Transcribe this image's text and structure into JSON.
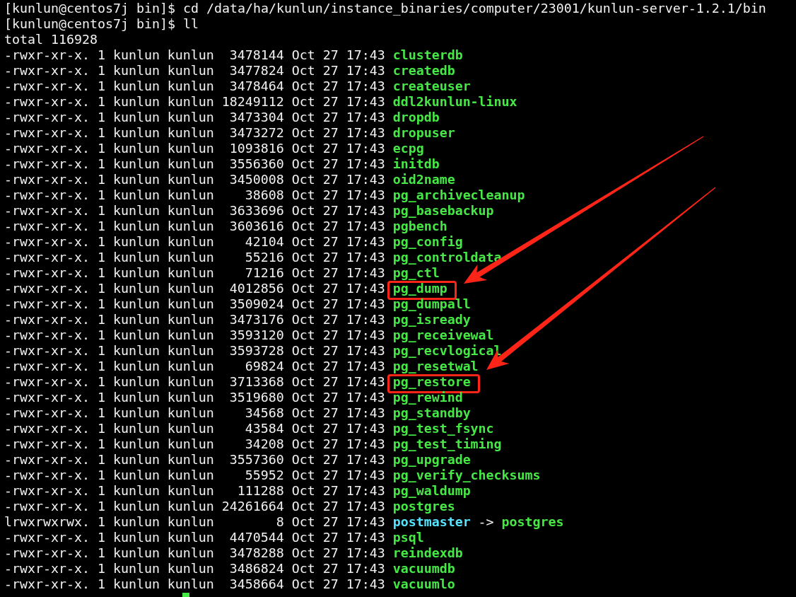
{
  "terminal": {
    "history": [
      {
        "kind": "prompt",
        "prompt": "[kunlun@centos7j bin]$",
        "command": "cd /data/ha/kunlun/instance_binaries/computer/23001/kunlun-server-1.2.1/bin"
      },
      {
        "kind": "prompt",
        "prompt": "[kunlun@centos7j bin]$",
        "command": "ll"
      },
      {
        "kind": "output",
        "text": "total 116928"
      }
    ],
    "listing": [
      {
        "permissions": "-rwxr-xr-x.",
        "links": "1",
        "owner": "kunlun",
        "group": "kunlun",
        "size": "3478144",
        "month": "Oct",
        "day": "27",
        "time": "17:43",
        "name": "clusterdb",
        "kind": "executable",
        "highlighted": false
      },
      {
        "permissions": "-rwxr-xr-x.",
        "links": "1",
        "owner": "kunlun",
        "group": "kunlun",
        "size": "3477824",
        "month": "Oct",
        "day": "27",
        "time": "17:43",
        "name": "createdb",
        "kind": "executable",
        "highlighted": false
      },
      {
        "permissions": "-rwxr-xr-x.",
        "links": "1",
        "owner": "kunlun",
        "group": "kunlun",
        "size": "3478464",
        "month": "Oct",
        "day": "27",
        "time": "17:43",
        "name": "createuser",
        "kind": "executable",
        "highlighted": false
      },
      {
        "permissions": "-rwxr-xr-x.",
        "links": "1",
        "owner": "kunlun",
        "group": "kunlun",
        "size": "18249112",
        "month": "Oct",
        "day": "27",
        "time": "17:43",
        "name": "ddl2kunlun-linux",
        "kind": "executable",
        "highlighted": false
      },
      {
        "permissions": "-rwxr-xr-x.",
        "links": "1",
        "owner": "kunlun",
        "group": "kunlun",
        "size": "3473304",
        "month": "Oct",
        "day": "27",
        "time": "17:43",
        "name": "dropdb",
        "kind": "executable",
        "highlighted": false
      },
      {
        "permissions": "-rwxr-xr-x.",
        "links": "1",
        "owner": "kunlun",
        "group": "kunlun",
        "size": "3473272",
        "month": "Oct",
        "day": "27",
        "time": "17:43",
        "name": "dropuser",
        "kind": "executable",
        "highlighted": false
      },
      {
        "permissions": "-rwxr-xr-x.",
        "links": "1",
        "owner": "kunlun",
        "group": "kunlun",
        "size": "1093816",
        "month": "Oct",
        "day": "27",
        "time": "17:43",
        "name": "ecpg",
        "kind": "executable",
        "highlighted": false
      },
      {
        "permissions": "-rwxr-xr-x.",
        "links": "1",
        "owner": "kunlun",
        "group": "kunlun",
        "size": "3556360",
        "month": "Oct",
        "day": "27",
        "time": "17:43",
        "name": "initdb",
        "kind": "executable",
        "highlighted": false
      },
      {
        "permissions": "-rwxr-xr-x.",
        "links": "1",
        "owner": "kunlun",
        "group": "kunlun",
        "size": "3450008",
        "month": "Oct",
        "day": "27",
        "time": "17:43",
        "name": "oid2name",
        "kind": "executable",
        "highlighted": false
      },
      {
        "permissions": "-rwxr-xr-x.",
        "links": "1",
        "owner": "kunlun",
        "group": "kunlun",
        "size": "38608",
        "month": "Oct",
        "day": "27",
        "time": "17:43",
        "name": "pg_archivecleanup",
        "kind": "executable",
        "highlighted": false
      },
      {
        "permissions": "-rwxr-xr-x.",
        "links": "1",
        "owner": "kunlun",
        "group": "kunlun",
        "size": "3633696",
        "month": "Oct",
        "day": "27",
        "time": "17:43",
        "name": "pg_basebackup",
        "kind": "executable",
        "highlighted": false
      },
      {
        "permissions": "-rwxr-xr-x.",
        "links": "1",
        "owner": "kunlun",
        "group": "kunlun",
        "size": "3603616",
        "month": "Oct",
        "day": "27",
        "time": "17:43",
        "name": "pgbench",
        "kind": "executable",
        "highlighted": false
      },
      {
        "permissions": "-rwxr-xr-x.",
        "links": "1",
        "owner": "kunlun",
        "group": "kunlun",
        "size": "42104",
        "month": "Oct",
        "day": "27",
        "time": "17:43",
        "name": "pg_config",
        "kind": "executable",
        "highlighted": false
      },
      {
        "permissions": "-rwxr-xr-x.",
        "links": "1",
        "owner": "kunlun",
        "group": "kunlun",
        "size": "55216",
        "month": "Oct",
        "day": "27",
        "time": "17:43",
        "name": "pg_controldata",
        "kind": "executable",
        "highlighted": false
      },
      {
        "permissions": "-rwxr-xr-x.",
        "links": "1",
        "owner": "kunlun",
        "group": "kunlun",
        "size": "71216",
        "month": "Oct",
        "day": "27",
        "time": "17:43",
        "name": "pg_ctl",
        "kind": "executable",
        "highlighted": false
      },
      {
        "permissions": "-rwxr-xr-x.",
        "links": "1",
        "owner": "kunlun",
        "group": "kunlun",
        "size": "4012856",
        "month": "Oct",
        "day": "27",
        "time": "17:43",
        "name": "pg_dump",
        "kind": "executable",
        "highlighted": true
      },
      {
        "permissions": "-rwxr-xr-x.",
        "links": "1",
        "owner": "kunlun",
        "group": "kunlun",
        "size": "3509024",
        "month": "Oct",
        "day": "27",
        "time": "17:43",
        "name": "pg_dumpall",
        "kind": "executable",
        "highlighted": false
      },
      {
        "permissions": "-rwxr-xr-x.",
        "links": "1",
        "owner": "kunlun",
        "group": "kunlun",
        "size": "3473176",
        "month": "Oct",
        "day": "27",
        "time": "17:43",
        "name": "pg_isready",
        "kind": "executable",
        "highlighted": false
      },
      {
        "permissions": "-rwxr-xr-x.",
        "links": "1",
        "owner": "kunlun",
        "group": "kunlun",
        "size": "3593120",
        "month": "Oct",
        "day": "27",
        "time": "17:43",
        "name": "pg_receivewal",
        "kind": "executable",
        "highlighted": false
      },
      {
        "permissions": "-rwxr-xr-x.",
        "links": "1",
        "owner": "kunlun",
        "group": "kunlun",
        "size": "3593728",
        "month": "Oct",
        "day": "27",
        "time": "17:43",
        "name": "pg_recvlogical",
        "kind": "executable",
        "highlighted": false
      },
      {
        "permissions": "-rwxr-xr-x.",
        "links": "1",
        "owner": "kunlun",
        "group": "kunlun",
        "size": "69824",
        "month": "Oct",
        "day": "27",
        "time": "17:43",
        "name": "pg_resetwal",
        "kind": "executable",
        "highlighted": false
      },
      {
        "permissions": "-rwxr-xr-x.",
        "links": "1",
        "owner": "kunlun",
        "group": "kunlun",
        "size": "3713368",
        "month": "Oct",
        "day": "27",
        "time": "17:43",
        "name": "pg_restore",
        "kind": "executable",
        "highlighted": true
      },
      {
        "permissions": "-rwxr-xr-x.",
        "links": "1",
        "owner": "kunlun",
        "group": "kunlun",
        "size": "3519680",
        "month": "Oct",
        "day": "27",
        "time": "17:43",
        "name": "pg_rewind",
        "kind": "executable",
        "highlighted": false
      },
      {
        "permissions": "-rwxr-xr-x.",
        "links": "1",
        "owner": "kunlun",
        "group": "kunlun",
        "size": "34568",
        "month": "Oct",
        "day": "27",
        "time": "17:43",
        "name": "pg_standby",
        "kind": "executable",
        "highlighted": false
      },
      {
        "permissions": "-rwxr-xr-x.",
        "links": "1",
        "owner": "kunlun",
        "group": "kunlun",
        "size": "43584",
        "month": "Oct",
        "day": "27",
        "time": "17:43",
        "name": "pg_test_fsync",
        "kind": "executable",
        "highlighted": false
      },
      {
        "permissions": "-rwxr-xr-x.",
        "links": "1",
        "owner": "kunlun",
        "group": "kunlun",
        "size": "34208",
        "month": "Oct",
        "day": "27",
        "time": "17:43",
        "name": "pg_test_timing",
        "kind": "executable",
        "highlighted": false
      },
      {
        "permissions": "-rwxr-xr-x.",
        "links": "1",
        "owner": "kunlun",
        "group": "kunlun",
        "size": "3557360",
        "month": "Oct",
        "day": "27",
        "time": "17:43",
        "name": "pg_upgrade",
        "kind": "executable",
        "highlighted": false
      },
      {
        "permissions": "-rwxr-xr-x.",
        "links": "1",
        "owner": "kunlun",
        "group": "kunlun",
        "size": "55952",
        "month": "Oct",
        "day": "27",
        "time": "17:43",
        "name": "pg_verify_checksums",
        "kind": "executable",
        "highlighted": false
      },
      {
        "permissions": "-rwxr-xr-x.",
        "links": "1",
        "owner": "kunlun",
        "group": "kunlun",
        "size": "111288",
        "month": "Oct",
        "day": "27",
        "time": "17:43",
        "name": "pg_waldump",
        "kind": "executable",
        "highlighted": false
      },
      {
        "permissions": "-rwxr-xr-x.",
        "links": "1",
        "owner": "kunlun",
        "group": "kunlun",
        "size": "24261664",
        "month": "Oct",
        "day": "27",
        "time": "17:43",
        "name": "postgres",
        "kind": "executable",
        "highlighted": false
      },
      {
        "permissions": "lrwxrwxrwx.",
        "links": "1",
        "owner": "kunlun",
        "group": "kunlun",
        "size": "8",
        "month": "Oct",
        "day": "27",
        "time": "17:43",
        "name": "postmaster",
        "kind": "symlink",
        "link_arrow": "->",
        "target": "postgres",
        "highlighted": false
      },
      {
        "permissions": "-rwxr-xr-x.",
        "links": "1",
        "owner": "kunlun",
        "group": "kunlun",
        "size": "4470544",
        "month": "Oct",
        "day": "27",
        "time": "17:43",
        "name": "psql",
        "kind": "executable",
        "highlighted": false
      },
      {
        "permissions": "-rwxr-xr-x.",
        "links": "1",
        "owner": "kunlun",
        "group": "kunlun",
        "size": "3478288",
        "month": "Oct",
        "day": "27",
        "time": "17:43",
        "name": "reindexdb",
        "kind": "executable",
        "highlighted": false
      },
      {
        "permissions": "-rwxr-xr-x.",
        "links": "1",
        "owner": "kunlun",
        "group": "kunlun",
        "size": "3486824",
        "month": "Oct",
        "day": "27",
        "time": "17:43",
        "name": "vacuumdb",
        "kind": "executable",
        "highlighted": false
      },
      {
        "permissions": "-rwxr-xr-x.",
        "links": "1",
        "owner": "kunlun",
        "group": "kunlun",
        "size": "3458664",
        "month": "Oct",
        "day": "27",
        "time": "17:43",
        "name": "vacuumlo",
        "kind": "executable",
        "highlighted": false
      }
    ]
  }
}
